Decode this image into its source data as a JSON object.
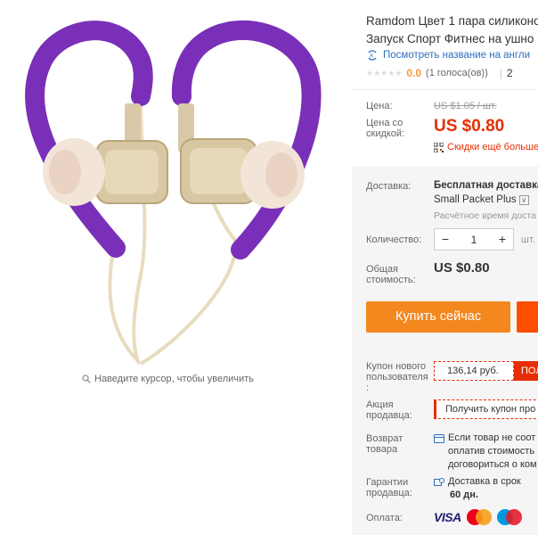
{
  "gallery": {
    "zoom_hint": "Наведите курсор, чтобы увеличить"
  },
  "product": {
    "title": "Ramdom Цвет 1 пара силиконо",
    "title_line2": "Запуск Спорт Фитнес на ушно",
    "translate_link": "Посмотреть название на англи",
    "rating_value": "0.0",
    "votes": "(1 голоса(ов))",
    "orders_prefix": "2"
  },
  "pricing": {
    "price_label": "Цена:",
    "old_price": "US $1.05 / шт.",
    "discount_label_1": "Цена со",
    "discount_label_2": "скидкой:",
    "new_price": "US $0.80",
    "app_discount": "Скидки ещё больше"
  },
  "shipping": {
    "label": "Доставка:",
    "title": "Бесплатная доставка",
    "method": "Small Packet Plus",
    "eta": "Расчётное время доста"
  },
  "quantity": {
    "label": "Количество:",
    "minus": "−",
    "value": "1",
    "plus": "+",
    "unit": "шт."
  },
  "total": {
    "label_1": "Общая",
    "label_2": "стоимость:",
    "value": "US $0.80"
  },
  "actions": {
    "buy_now": "Купить сейчас"
  },
  "coupons": {
    "new_user_label_1": "Купон нового",
    "new_user_label_2": "пользователя",
    "new_user_label_3": ":",
    "new_user_code": "136,14 руб.",
    "new_user_get": "ПОЛ",
    "seller_label_1": "Акция",
    "seller_label_2": "продавца:",
    "seller_coupon": "Получить купон про"
  },
  "returns": {
    "label_1": "Возврат",
    "label_2": "товара",
    "text_1": "Если товар не соот",
    "text_2": "оплатив стоимость",
    "text_3": "договориться о ком"
  },
  "guarantee": {
    "label_1": "Гарантии",
    "label_2": "продавца:",
    "text": "Доставка в срок",
    "days": "60 дн."
  },
  "payment": {
    "label": "Оплата:",
    "visa": "VISA"
  },
  "colors": {
    "accent_orange": "#f5871f",
    "price_red": "#e62e04",
    "link_blue": "#2f6fc1",
    "earhook_purple": "#7a2fb8"
  }
}
